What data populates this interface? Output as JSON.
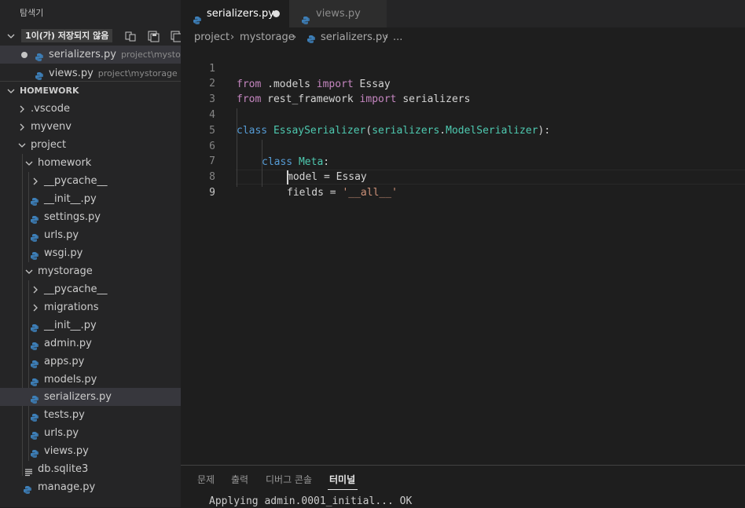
{
  "sidebar": {
    "title": "탐색기",
    "open_editors": {
      "badge": "1이(가) 저장되지 않음",
      "items": [
        {
          "name": "serializers.py",
          "path": "project\\mysto..."
        },
        {
          "name": "views.py",
          "path": "project\\mystorage"
        }
      ]
    },
    "workspace": "HOMEWORK",
    "tree": [
      ".vscode",
      "myvenv",
      "project",
      "homework",
      "__pycache__",
      "__init__.py",
      "settings.py",
      "urls.py",
      "wsgi.py",
      "mystorage",
      "__pycache__",
      "migrations",
      "__init__.py",
      "admin.py",
      "apps.py",
      "models.py",
      "serializers.py",
      "tests.py",
      "urls.py",
      "views.py",
      "db.sqlite3",
      "manage.py"
    ]
  },
  "tabs": [
    {
      "label": "serializers.py",
      "active": true,
      "dirty": true
    },
    {
      "label": "views.py",
      "active": false,
      "dirty": false
    }
  ],
  "breadcrumb": [
    "project",
    "mystorage",
    "serializers.py",
    "..."
  ],
  "editor": {
    "line_numbers": [
      "1",
      "2",
      "3",
      "4",
      "5",
      "6",
      "7",
      "8",
      "9"
    ],
    "active_line": 9
  },
  "code": {
    "l1_from": "from",
    "l1_mod": " .models ",
    "l1_import": "import",
    "l1_name": " Essay",
    "l2_from": "from",
    "l2_mod": " rest_framework ",
    "l2_import": "import",
    "l2_name": " serializers",
    "l4_class": "class",
    "l4_name": "EssaySerializer",
    "l4_open": "(",
    "l4_base1": "serializers",
    "l4_dot": ".",
    "l4_base2": "ModelSerializer",
    "l4_close": "):",
    "l6_class": "class",
    "l6_name": "Meta",
    "l6_colon": ":",
    "l7_text": "model = Essay",
    "l8_text": "fields = ",
    "l8_str": "'__all__'"
  },
  "panel": {
    "tabs": [
      "문제",
      "출력",
      "디버그 콘솔",
      "터미널"
    ],
    "active_tab": "터미널",
    "terminal_line": "Applying admin.0001_initial... OK"
  },
  "colors": {
    "keyword": "#c586c0",
    "class_keyword": "#569cd6",
    "type": "#4ec9b0",
    "string": "#ce9178",
    "python_icon": "#3d7fb8"
  }
}
